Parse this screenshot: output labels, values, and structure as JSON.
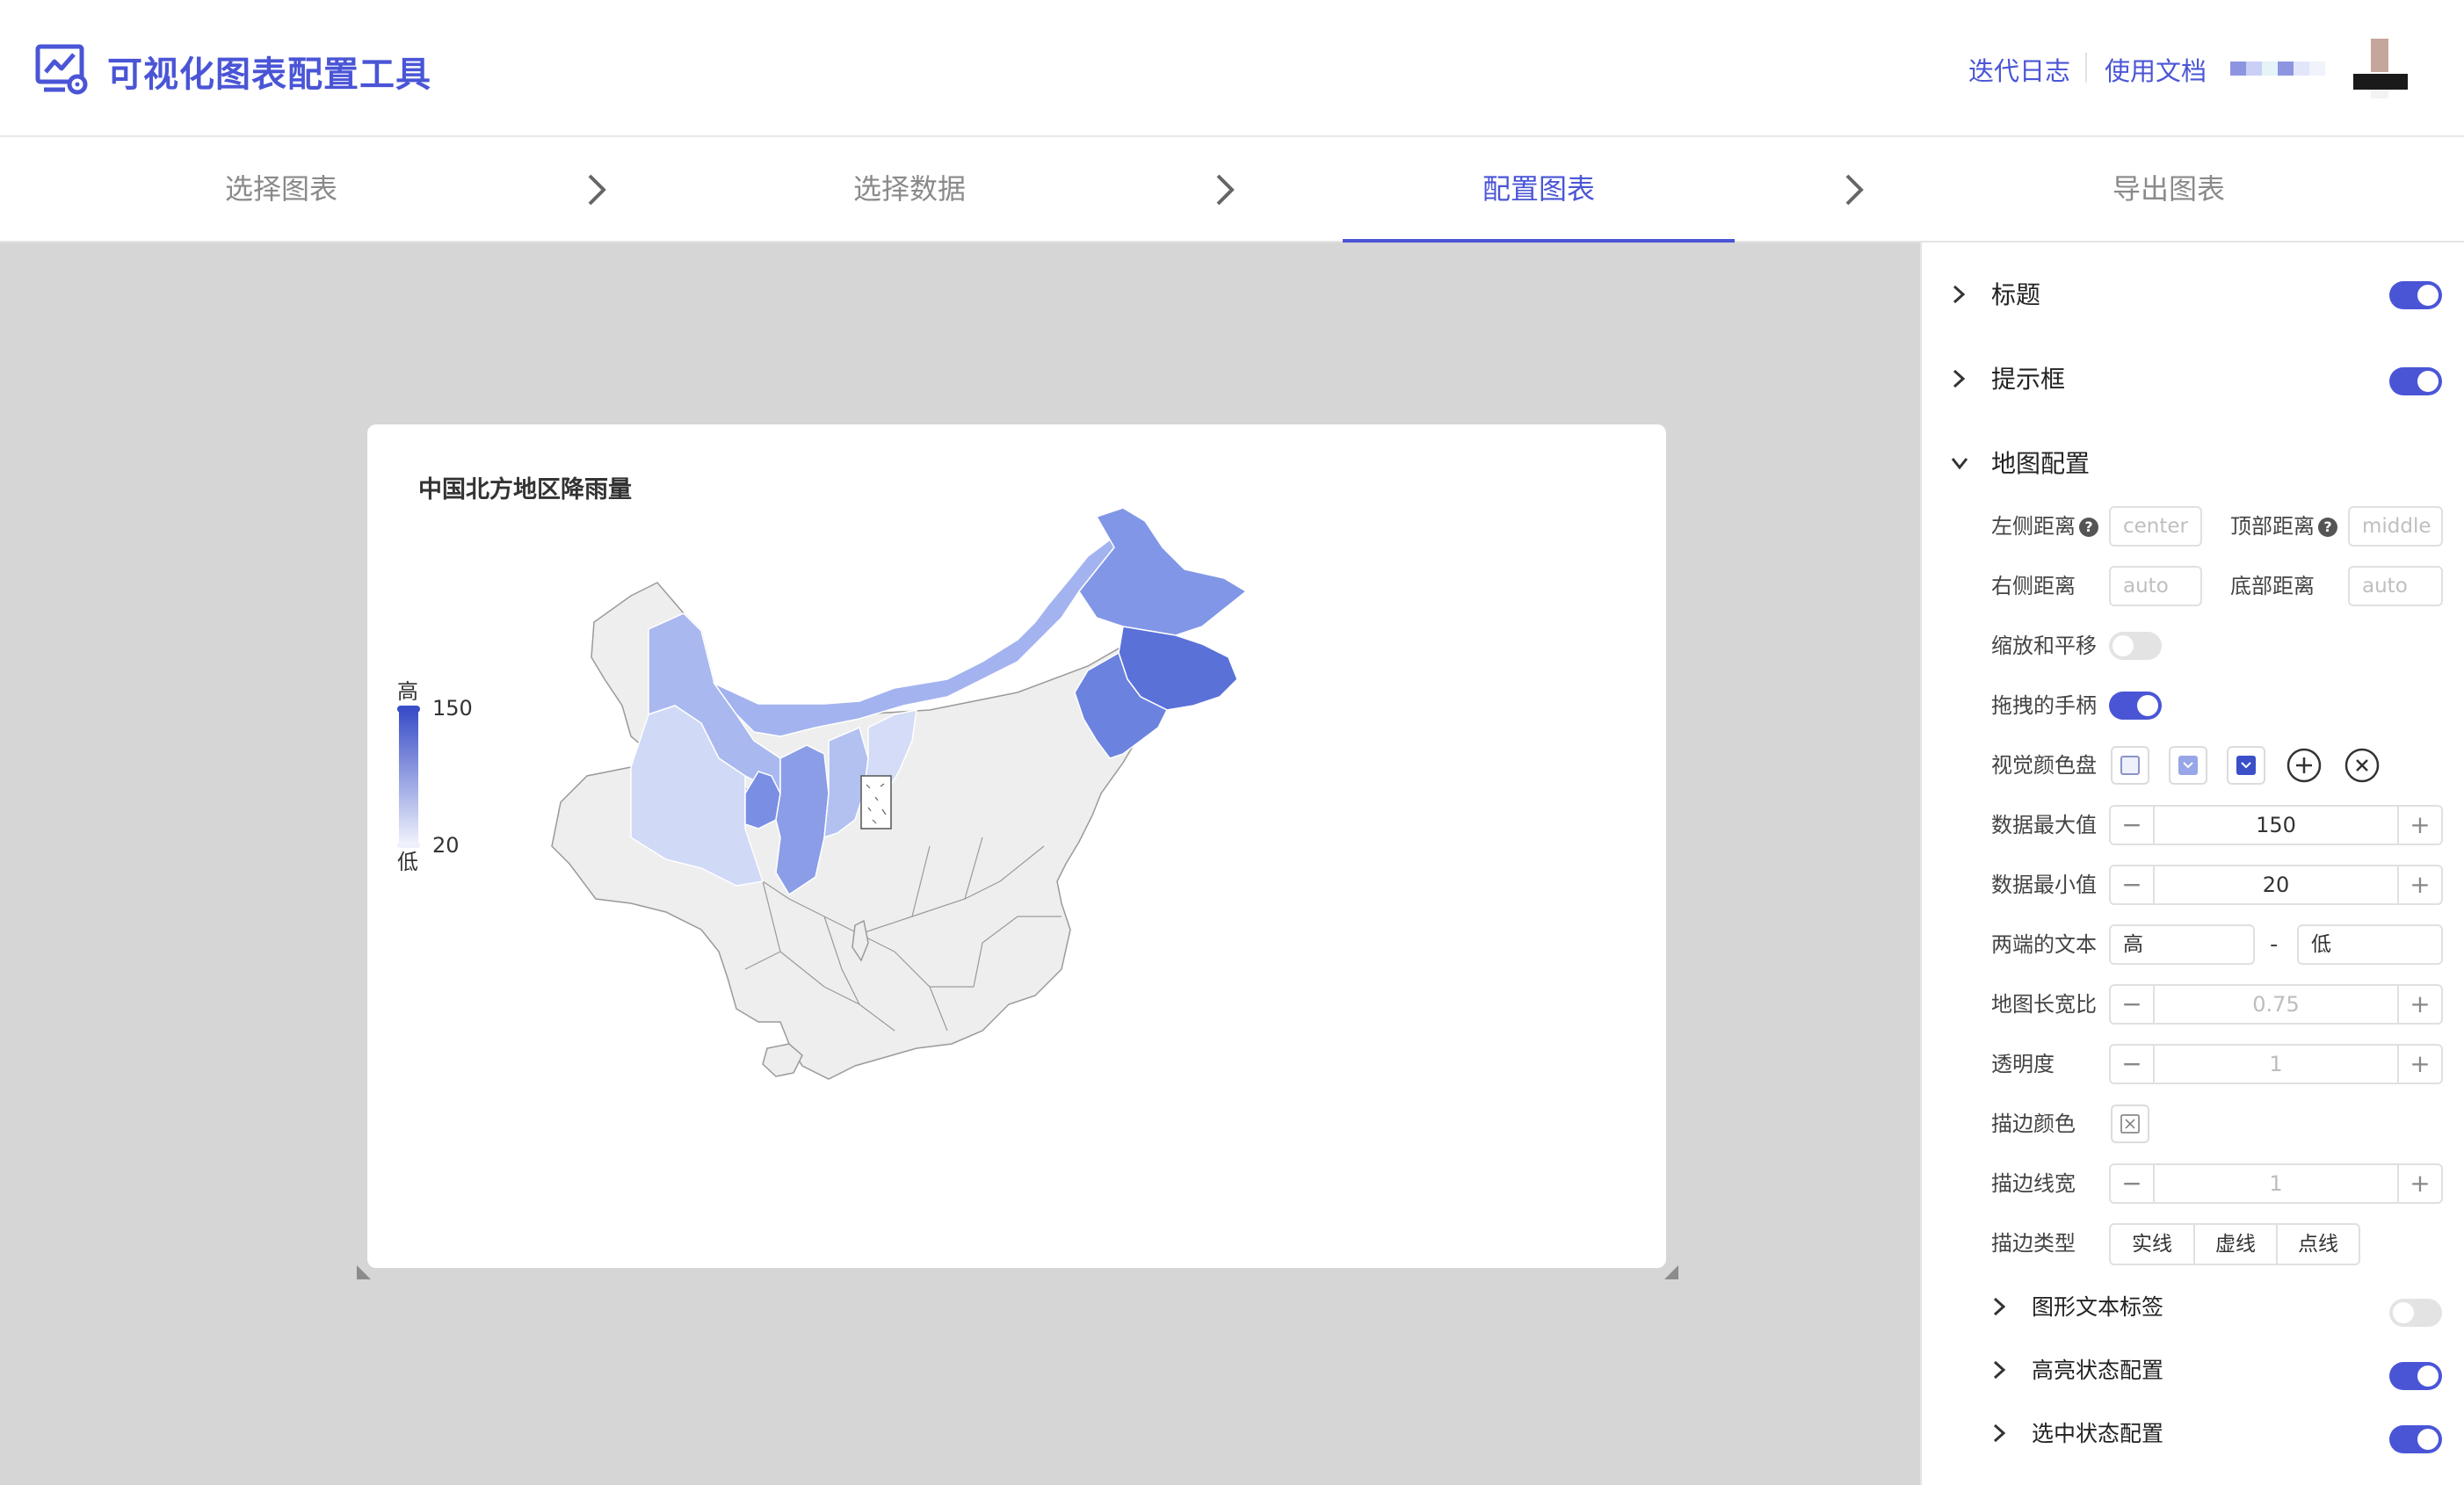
{
  "header": {
    "app_title": "可视化图表配置工具",
    "links": {
      "changelog": "迭代日志",
      "docs": "使用文档"
    }
  },
  "steps": [
    "选择图表",
    "选择数据",
    "配置图表",
    "导出图表"
  ],
  "active_step": 2,
  "chart": {
    "title": "中国北方地区降雨量",
    "legend_high": "高",
    "legend_low": "低",
    "legend_max": "150",
    "legend_min": "20",
    "visual_colors": [
      "#eef0fb",
      "#97a6e8",
      "#3a4fc8"
    ]
  },
  "chart_data": {
    "type": "heatmap",
    "subtype": "choropleth-map",
    "title": "中国北方地区降雨量",
    "visual_map": {
      "min": 20,
      "max": 150,
      "text": [
        "高",
        "低"
      ],
      "colors": [
        "#eef0fb",
        "#97a6e8",
        "#3a4fc8"
      ]
    }
  },
  "panel": {
    "sections": {
      "title": {
        "label": "标题",
        "enabled": true
      },
      "tooltip": {
        "label": "提示框",
        "enabled": true
      },
      "map": {
        "label": "地图配置",
        "expanded": true
      }
    },
    "map_config": {
      "left_label": "左侧距离",
      "left_placeholder": "center",
      "top_label": "顶部距离",
      "top_placeholder": "middle",
      "right_label": "右侧距离",
      "right_placeholder": "auto",
      "bottom_label": "底部距离",
      "bottom_placeholder": "auto",
      "roam_label": "缩放和平移",
      "roam_enabled": false,
      "handle_label": "拖拽的手柄",
      "handle_enabled": true,
      "palette_label": "视觉颜色盘",
      "max_label": "数据最大值",
      "max_value": "150",
      "min_label": "数据最小值",
      "min_value": "20",
      "text_label": "两端的文本",
      "text_high": "高",
      "text_sep": "-",
      "text_low": "低",
      "aspect_label": "地图长宽比",
      "aspect_value": "0.75",
      "opacity_label": "透明度",
      "opacity_value": "1",
      "border_color_label": "描边颜色",
      "border_width_label": "描边线宽",
      "border_width_value": "1",
      "border_type_label": "描边类型",
      "border_types": [
        "实线",
        "虚线",
        "点线"
      ]
    },
    "subsections": {
      "label": {
        "label": "图形文本标签",
        "enabled": false
      },
      "emphasis": {
        "label": "高亮状态配置",
        "enabled": true
      },
      "select": {
        "label": "选中状态配置",
        "enabled": true
      }
    }
  }
}
